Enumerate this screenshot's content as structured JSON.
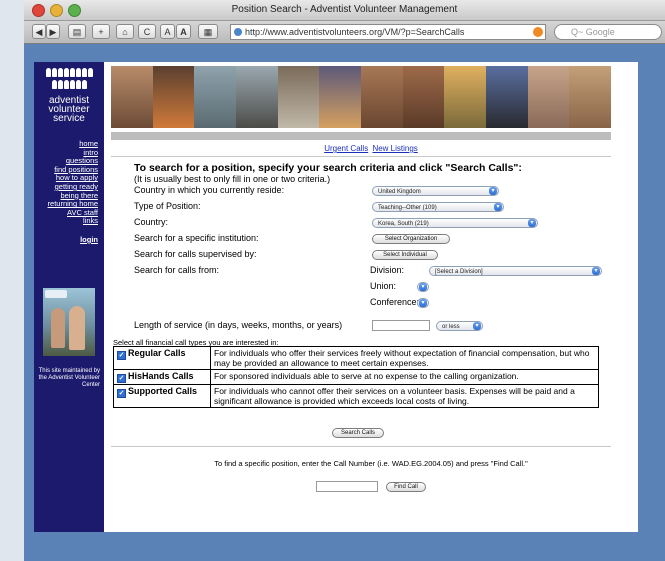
{
  "window": {
    "title": "Position Search - Adventist Volunteer Management"
  },
  "toolbar": {
    "back": "◀",
    "forward": "▶",
    "reader": "▤",
    "add": "+",
    "home": "⌂",
    "reload": "C",
    "text_small": "A",
    "text_large": "A",
    "print": "▦",
    "url": "http://www.adventistvolunteers.org/VM/?p=SearchCalls",
    "search_placeholder": "Q~ Google"
  },
  "sidebar": {
    "logo_lines": [
      "adventist",
      "volunteer",
      "service"
    ],
    "nav": [
      "home",
      "intro",
      "questions",
      "find positions",
      "how to apply",
      "getting ready",
      "being there",
      "returning home",
      "AVC staff",
      "links"
    ],
    "login": "login",
    "note": "This site maintained by the Adventist Volunteer Center"
  },
  "links": {
    "urgent": "Urgent Calls",
    "new": "New Listings"
  },
  "form": {
    "heading": "To search for a position, specify your search criteria and click \"Search Calls\":",
    "subheading": "(It is usually best to only fill in one or two criteria.)",
    "country_reside_label": "Country in which you currently reside:",
    "country_reside_value": "United Kingdom",
    "type_label": "Type of Position:",
    "type_value": "Teaching--Other (109)",
    "country_label": "Country:",
    "country_value": "Korea, South (219)",
    "institution_label": "Search for a specific institution:",
    "institution_button": "Select Organization",
    "supervised_label": "Search for calls supervised by:",
    "supervised_button": "Select Individual",
    "from_label": "Search for calls from:",
    "division_label": "Division:",
    "division_value": "[Select a Division]",
    "union_label": "Union:",
    "conference_label": "Conference:",
    "length_label": "Length of service (in days, weeks, months, or years)",
    "length_value": "",
    "length_compare": "or less",
    "financial_intro": "Select all financial call types you are interested in:",
    "call_types": [
      {
        "name": "Regular Calls",
        "checked": true,
        "desc": "For individuals who offer their services freely without expectation of financial compensation, but who may be provided an allowance to meet certain expenses."
      },
      {
        "name": "HisHands Calls",
        "checked": true,
        "desc": "For sponsored individuals able to serve at no expense to the calling organization."
      },
      {
        "name": "Supported Calls",
        "checked": true,
        "desc": "For individuals who cannot offer their services on a volunteer basis. Expenses will be paid and a significant allowance is provided which exceeds local costs of living."
      }
    ],
    "search_button": "Search Calls",
    "find_text": "To find a specific position, enter the Call Number (i.e. WAD.EG.2004.05) and press \"Find Call.\"",
    "find_value": "",
    "find_button": "Find Call"
  }
}
